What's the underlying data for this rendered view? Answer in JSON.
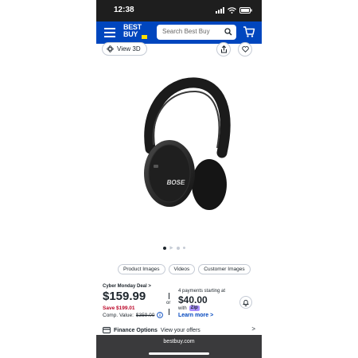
{
  "status_bar": {
    "time": "12:38"
  },
  "header": {
    "logo_line1": "BEST",
    "logo_line2": "BUY",
    "search_placeholder": "Search Best Buy",
    "brand_color": "#0046be",
    "logo_tag_color": "#ffe000"
  },
  "toolbar": {
    "view3d_label": "View 3D"
  },
  "product": {
    "image_alt": "Bose headphones",
    "brand_text": "BOSE",
    "carousel": {
      "count": 4,
      "active_index": 0
    }
  },
  "media_tabs": [
    "Product Images",
    "Videos",
    "Customer Images"
  ],
  "pricing": {
    "deal_label": "Cyber Monday Deal",
    "deal_arrow": ">",
    "price": "$159.99",
    "save": "Save $199.01",
    "comp_label": "Comp. Value:",
    "comp_value": "$359.00",
    "sale_color": "#bb0628"
  },
  "payments": {
    "or_label": "or",
    "starting_label": "4 payments starting at",
    "amount": "$40.00",
    "with_label": "with",
    "provider": "Zip",
    "learn_more": "Learn more >"
  },
  "finance": {
    "label": "Finance Options",
    "link": "View your offers",
    "chevron": ">"
  },
  "browser": {
    "url": "bestbuy.com"
  }
}
